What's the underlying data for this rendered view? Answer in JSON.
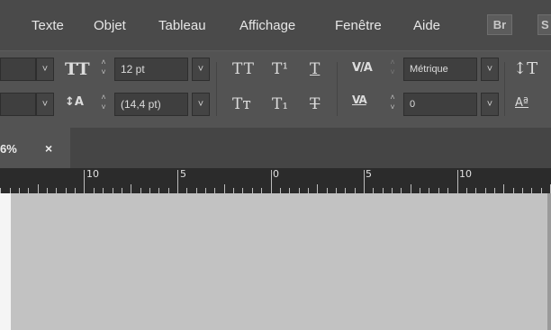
{
  "menubar": {
    "items": [
      "Texte",
      "Objet",
      "Tableau",
      "Affichage",
      "Fenêtre",
      "Aide"
    ],
    "bridge_badge": "Br",
    "next_badge": "S"
  },
  "control_panel": {
    "row1": {
      "font_size_icon": "TT",
      "font_size_value": "12 pt",
      "all_caps": "TT",
      "superscript": "T¹",
      "underline": "T",
      "kerning_value": "Métrique",
      "vertical_scale_icon": "↕T"
    },
    "row2": {
      "leading_icon": "↕A",
      "leading_value": "(14,4 pt)",
      "small_caps": "Tт",
      "subscript": "T₁",
      "strikethrough": "T",
      "tracking_value": "0",
      "baseline_icon": "Aª"
    },
    "chevron": "˅",
    "spin_up": "˄",
    "spin_down": "˅"
  },
  "document_tab": {
    "label": "6%",
    "close": "×"
  },
  "ruler": {
    "labels": [
      "10",
      "5",
      "0",
      "5",
      "10"
    ]
  },
  "colors": {
    "menubar": "#4a4a4a",
    "panel": "#535353",
    "ruler": "#2b2b2b",
    "pasteboard": "#c2c2c2"
  }
}
